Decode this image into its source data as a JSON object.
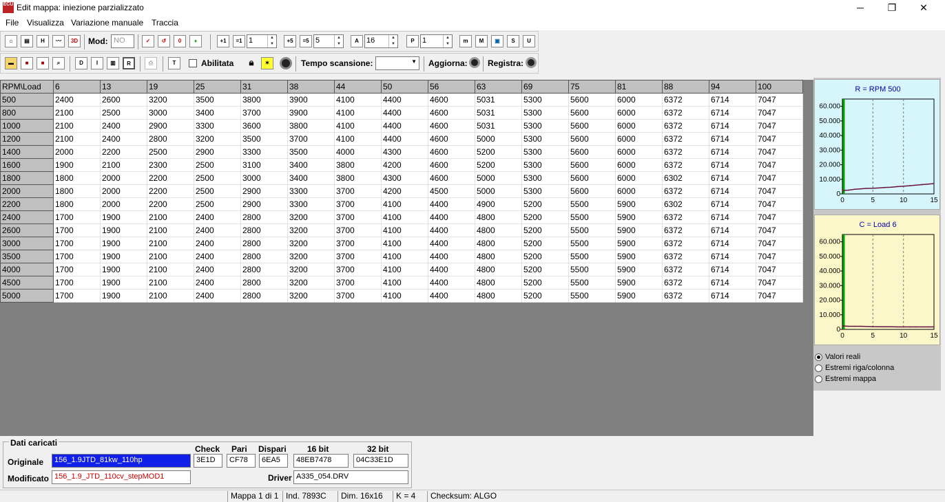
{
  "window": {
    "title": "Edit mappa: iniezione parzializzato",
    "icon_text": "ECU"
  },
  "menu": [
    "File",
    "Visualizza",
    "Variazione manuale",
    "Traccia"
  ],
  "toolbar1": {
    "mod_label": "Mod:",
    "mod_value": "NO",
    "icons1": [
      "home-icon",
      "windows-icon",
      "h-icon",
      "graph2d-icon",
      "3d-icon"
    ],
    "icon_texts1": [
      "⌂",
      "▤",
      "H",
      "〰",
      "3D"
    ],
    "icons2": [
      "check-red-icon",
      "undo-red-icon",
      "zero-icon",
      "color-icon"
    ],
    "icon_texts2": [
      "✓",
      "↺",
      "0",
      "♦"
    ],
    "spin1": "1",
    "spin2": "5",
    "spin3": "16",
    "spin4": "1",
    "icons3": [
      "m-icon",
      "M-icon",
      "screen-icon",
      "S-icon",
      "U-icon"
    ],
    "icon_texts3": [
      "m",
      "M",
      "▣",
      "S",
      "U"
    ]
  },
  "toolbar2": {
    "abilitata": "Abilitata",
    "tempo": "Tempo scansione:",
    "aggiorna": "Aggiorna:",
    "registra": "Registra:",
    "tempo_value": ""
  },
  "grid": {
    "corner": "RPM\\Load",
    "columns": [
      "6",
      "13",
      "19",
      "25",
      "31",
      "38",
      "44",
      "50",
      "56",
      "63",
      "69",
      "75",
      "81",
      "88",
      "94",
      "100"
    ],
    "rows": [
      {
        "rpm": "500",
        "v": [
          "2400",
          "2600",
          "3200",
          "3500",
          "3800",
          "3900",
          "4100",
          "4400",
          "4600",
          "5031",
          "5300",
          "5600",
          "6000",
          "6372",
          "6714",
          "7047"
        ]
      },
      {
        "rpm": "800",
        "v": [
          "2100",
          "2500",
          "3000",
          "3400",
          "3700",
          "3900",
          "4100",
          "4400",
          "4600",
          "5031",
          "5300",
          "5600",
          "6000",
          "6372",
          "6714",
          "7047"
        ]
      },
      {
        "rpm": "1000",
        "v": [
          "2100",
          "2400",
          "2900",
          "3300",
          "3600",
          "3800",
          "4100",
          "4400",
          "4600",
          "5031",
          "5300",
          "5600",
          "6000",
          "6372",
          "6714",
          "7047"
        ]
      },
      {
        "rpm": "1200",
        "v": [
          "2100",
          "2400",
          "2800",
          "3200",
          "3500",
          "3700",
          "4100",
          "4400",
          "4600",
          "5000",
          "5300",
          "5600",
          "6000",
          "6372",
          "6714",
          "7047"
        ]
      },
      {
        "rpm": "1400",
        "v": [
          "2000",
          "2200",
          "2500",
          "2900",
          "3300",
          "3500",
          "4000",
          "4300",
          "4600",
          "5200",
          "5300",
          "5600",
          "6000",
          "6372",
          "6714",
          "7047"
        ]
      },
      {
        "rpm": "1600",
        "v": [
          "1900",
          "2100",
          "2300",
          "2500",
          "3100",
          "3400",
          "3800",
          "4200",
          "4600",
          "5200",
          "5300",
          "5600",
          "6000",
          "6372",
          "6714",
          "7047"
        ]
      },
      {
        "rpm": "1800",
        "v": [
          "1800",
          "2000",
          "2200",
          "2500",
          "3000",
          "3400",
          "3800",
          "4300",
          "4600",
          "5000",
          "5300",
          "5600",
          "6000",
          "6302",
          "6714",
          "7047"
        ]
      },
      {
        "rpm": "2000",
        "v": [
          "1800",
          "2000",
          "2200",
          "2500",
          "2900",
          "3300",
          "3700",
          "4200",
          "4500",
          "5000",
          "5300",
          "5600",
          "6000",
          "6372",
          "6714",
          "7047"
        ]
      },
      {
        "rpm": "2200",
        "v": [
          "1800",
          "2000",
          "2200",
          "2500",
          "2900",
          "3300",
          "3700",
          "4100",
          "4400",
          "4900",
          "5200",
          "5500",
          "5900",
          "6302",
          "6714",
          "7047"
        ]
      },
      {
        "rpm": "2400",
        "v": [
          "1700",
          "1900",
          "2100",
          "2400",
          "2800",
          "3200",
          "3700",
          "4100",
          "4400",
          "4800",
          "5200",
          "5500",
          "5900",
          "6372",
          "6714",
          "7047"
        ]
      },
      {
        "rpm": "2600",
        "v": [
          "1700",
          "1900",
          "2100",
          "2400",
          "2800",
          "3200",
          "3700",
          "4100",
          "4400",
          "4800",
          "5200",
          "5500",
          "5900",
          "6372",
          "6714",
          "7047"
        ]
      },
      {
        "rpm": "3000",
        "v": [
          "1700",
          "1900",
          "2100",
          "2400",
          "2800",
          "3200",
          "3700",
          "4100",
          "4400",
          "4800",
          "5200",
          "5500",
          "5900",
          "6372",
          "6714",
          "7047"
        ]
      },
      {
        "rpm": "3500",
        "v": [
          "1700",
          "1900",
          "2100",
          "2400",
          "2800",
          "3200",
          "3700",
          "4100",
          "4400",
          "4800",
          "5200",
          "5500",
          "5900",
          "6372",
          "6714",
          "7047"
        ]
      },
      {
        "rpm": "4000",
        "v": [
          "1700",
          "1900",
          "2100",
          "2400",
          "2800",
          "3200",
          "3700",
          "4100",
          "4400",
          "4800",
          "5200",
          "5500",
          "5900",
          "6372",
          "6714",
          "7047"
        ]
      },
      {
        "rpm": "4500",
        "v": [
          "1700",
          "1900",
          "2100",
          "2400",
          "2800",
          "3200",
          "3700",
          "4100",
          "4400",
          "4800",
          "5200",
          "5500",
          "5900",
          "6372",
          "6714",
          "7047"
        ]
      },
      {
        "rpm": "5000",
        "v": [
          "1700",
          "1900",
          "2100",
          "2400",
          "2800",
          "3200",
          "3700",
          "4100",
          "4400",
          "4800",
          "5200",
          "5500",
          "5900",
          "6372",
          "6714",
          "7047"
        ]
      }
    ]
  },
  "charts": [
    {
      "title": "R = RPM 500",
      "bg": "#d7f6fb",
      "y_ticks": [
        "60.000",
        "50.000",
        "40.000",
        "30.000",
        "20.000",
        "10.000",
        "0"
      ],
      "x_ticks": [
        "0",
        "5",
        "10",
        "15"
      ],
      "ylim": [
        0,
        65000
      ],
      "xlim": [
        0,
        15
      ],
      "series": [
        2400,
        2600,
        3200,
        3500,
        3800,
        3900,
        4100,
        4400,
        4600,
        5031,
        5300,
        5600,
        6000,
        6372,
        6714,
        7047
      ]
    },
    {
      "title": "C = Load 6",
      "bg": "#fbf7c8",
      "y_ticks": [
        "60.000",
        "50.000",
        "40.000",
        "30.000",
        "20.000",
        "10.000",
        "0"
      ],
      "x_ticks": [
        "0",
        "5",
        "10",
        "15"
      ],
      "ylim": [
        0,
        65000
      ],
      "xlim": [
        0,
        15
      ],
      "series": [
        2400,
        2100,
        2100,
        2100,
        2000,
        1900,
        1800,
        1800,
        1800,
        1700,
        1700,
        1700,
        1700,
        1700,
        1700,
        1700
      ]
    }
  ],
  "radios": [
    {
      "label": "Valori reali",
      "checked": true
    },
    {
      "label": "Estremi riga/colonna",
      "checked": false
    },
    {
      "label": "Estremi mappa",
      "checked": false
    }
  ],
  "dati": {
    "legend": "Dati caricati",
    "originale_label": "Originale",
    "originale_value": "156_1.9JTD_81kw_110hp",
    "modificato_label": "Modificato",
    "modificato_value": "156_1.9_JTD_110cv_stepMOD1",
    "check_label": "Check",
    "check_value": "3E1D",
    "pari_label": "Pari",
    "pari_value": "CF78",
    "dispari_label": "Dispari",
    "dispari_value": "6EA5",
    "b16_label": "16 bit",
    "b16_value": "48EB7478",
    "b32_label": "32 bit",
    "b32_value": "04C33E1D",
    "driver_label": "Driver",
    "driver_value": "A335_054.DRV"
  },
  "status": [
    "Mappa 1 di 1",
    "Ind. 7893C",
    "Dim. 16x16",
    "K = 4",
    "Checksum: ALGO"
  ]
}
